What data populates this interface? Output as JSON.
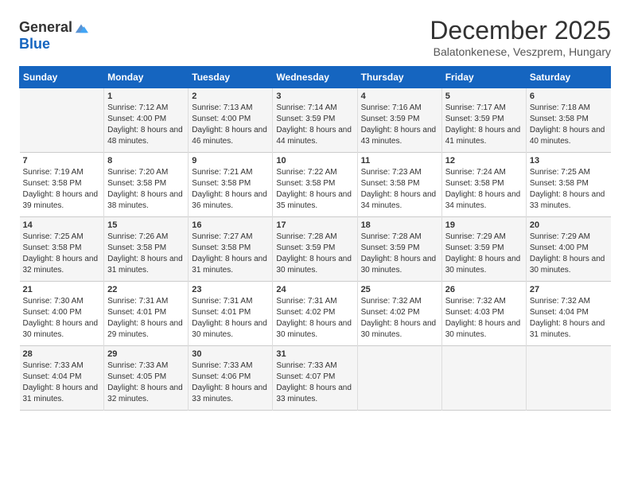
{
  "header": {
    "logo_general": "General",
    "logo_blue": "Blue",
    "title": "December 2025",
    "location": "Balatonkenese, Veszprem, Hungary"
  },
  "weekdays": [
    "Sunday",
    "Monday",
    "Tuesday",
    "Wednesday",
    "Thursday",
    "Friday",
    "Saturday"
  ],
  "weeks": [
    [
      {
        "day": "",
        "sunrise": "",
        "sunset": "",
        "daylight": ""
      },
      {
        "day": "1",
        "sunrise": "Sunrise: 7:12 AM",
        "sunset": "Sunset: 4:00 PM",
        "daylight": "Daylight: 8 hours and 48 minutes."
      },
      {
        "day": "2",
        "sunrise": "Sunrise: 7:13 AM",
        "sunset": "Sunset: 4:00 PM",
        "daylight": "Daylight: 8 hours and 46 minutes."
      },
      {
        "day": "3",
        "sunrise": "Sunrise: 7:14 AM",
        "sunset": "Sunset: 3:59 PM",
        "daylight": "Daylight: 8 hours and 44 minutes."
      },
      {
        "day": "4",
        "sunrise": "Sunrise: 7:16 AM",
        "sunset": "Sunset: 3:59 PM",
        "daylight": "Daylight: 8 hours and 43 minutes."
      },
      {
        "day": "5",
        "sunrise": "Sunrise: 7:17 AM",
        "sunset": "Sunset: 3:59 PM",
        "daylight": "Daylight: 8 hours and 41 minutes."
      },
      {
        "day": "6",
        "sunrise": "Sunrise: 7:18 AM",
        "sunset": "Sunset: 3:58 PM",
        "daylight": "Daylight: 8 hours and 40 minutes."
      }
    ],
    [
      {
        "day": "7",
        "sunrise": "Sunrise: 7:19 AM",
        "sunset": "Sunset: 3:58 PM",
        "daylight": "Daylight: 8 hours and 39 minutes."
      },
      {
        "day": "8",
        "sunrise": "Sunrise: 7:20 AM",
        "sunset": "Sunset: 3:58 PM",
        "daylight": "Daylight: 8 hours and 38 minutes."
      },
      {
        "day": "9",
        "sunrise": "Sunrise: 7:21 AM",
        "sunset": "Sunset: 3:58 PM",
        "daylight": "Daylight: 8 hours and 36 minutes."
      },
      {
        "day": "10",
        "sunrise": "Sunrise: 7:22 AM",
        "sunset": "Sunset: 3:58 PM",
        "daylight": "Daylight: 8 hours and 35 minutes."
      },
      {
        "day": "11",
        "sunrise": "Sunrise: 7:23 AM",
        "sunset": "Sunset: 3:58 PM",
        "daylight": "Daylight: 8 hours and 34 minutes."
      },
      {
        "day": "12",
        "sunrise": "Sunrise: 7:24 AM",
        "sunset": "Sunset: 3:58 PM",
        "daylight": "Daylight: 8 hours and 34 minutes."
      },
      {
        "day": "13",
        "sunrise": "Sunrise: 7:25 AM",
        "sunset": "Sunset: 3:58 PM",
        "daylight": "Daylight: 8 hours and 33 minutes."
      }
    ],
    [
      {
        "day": "14",
        "sunrise": "Sunrise: 7:25 AM",
        "sunset": "Sunset: 3:58 PM",
        "daylight": "Daylight: 8 hours and 32 minutes."
      },
      {
        "day": "15",
        "sunrise": "Sunrise: 7:26 AM",
        "sunset": "Sunset: 3:58 PM",
        "daylight": "Daylight: 8 hours and 31 minutes."
      },
      {
        "day": "16",
        "sunrise": "Sunrise: 7:27 AM",
        "sunset": "Sunset: 3:58 PM",
        "daylight": "Daylight: 8 hours and 31 minutes."
      },
      {
        "day": "17",
        "sunrise": "Sunrise: 7:28 AM",
        "sunset": "Sunset: 3:59 PM",
        "daylight": "Daylight: 8 hours and 30 minutes."
      },
      {
        "day": "18",
        "sunrise": "Sunrise: 7:28 AM",
        "sunset": "Sunset: 3:59 PM",
        "daylight": "Daylight: 8 hours and 30 minutes."
      },
      {
        "day": "19",
        "sunrise": "Sunrise: 7:29 AM",
        "sunset": "Sunset: 3:59 PM",
        "daylight": "Daylight: 8 hours and 30 minutes."
      },
      {
        "day": "20",
        "sunrise": "Sunrise: 7:29 AM",
        "sunset": "Sunset: 4:00 PM",
        "daylight": "Daylight: 8 hours and 30 minutes."
      }
    ],
    [
      {
        "day": "21",
        "sunrise": "Sunrise: 7:30 AM",
        "sunset": "Sunset: 4:00 PM",
        "daylight": "Daylight: 8 hours and 30 minutes."
      },
      {
        "day": "22",
        "sunrise": "Sunrise: 7:31 AM",
        "sunset": "Sunset: 4:01 PM",
        "daylight": "Daylight: 8 hours and 29 minutes."
      },
      {
        "day": "23",
        "sunrise": "Sunrise: 7:31 AM",
        "sunset": "Sunset: 4:01 PM",
        "daylight": "Daylight: 8 hours and 30 minutes."
      },
      {
        "day": "24",
        "sunrise": "Sunrise: 7:31 AM",
        "sunset": "Sunset: 4:02 PM",
        "daylight": "Daylight: 8 hours and 30 minutes."
      },
      {
        "day": "25",
        "sunrise": "Sunrise: 7:32 AM",
        "sunset": "Sunset: 4:02 PM",
        "daylight": "Daylight: 8 hours and 30 minutes."
      },
      {
        "day": "26",
        "sunrise": "Sunrise: 7:32 AM",
        "sunset": "Sunset: 4:03 PM",
        "daylight": "Daylight: 8 hours and 30 minutes."
      },
      {
        "day": "27",
        "sunrise": "Sunrise: 7:32 AM",
        "sunset": "Sunset: 4:04 PM",
        "daylight": "Daylight: 8 hours and 31 minutes."
      }
    ],
    [
      {
        "day": "28",
        "sunrise": "Sunrise: 7:33 AM",
        "sunset": "Sunset: 4:04 PM",
        "daylight": "Daylight: 8 hours and 31 minutes."
      },
      {
        "day": "29",
        "sunrise": "Sunrise: 7:33 AM",
        "sunset": "Sunset: 4:05 PM",
        "daylight": "Daylight: 8 hours and 32 minutes."
      },
      {
        "day": "30",
        "sunrise": "Sunrise: 7:33 AM",
        "sunset": "Sunset: 4:06 PM",
        "daylight": "Daylight: 8 hours and 33 minutes."
      },
      {
        "day": "31",
        "sunrise": "Sunrise: 7:33 AM",
        "sunset": "Sunset: 4:07 PM",
        "daylight": "Daylight: 8 hours and 33 minutes."
      },
      {
        "day": "",
        "sunrise": "",
        "sunset": "",
        "daylight": ""
      },
      {
        "day": "",
        "sunrise": "",
        "sunset": "",
        "daylight": ""
      },
      {
        "day": "",
        "sunrise": "",
        "sunset": "",
        "daylight": ""
      }
    ]
  ]
}
